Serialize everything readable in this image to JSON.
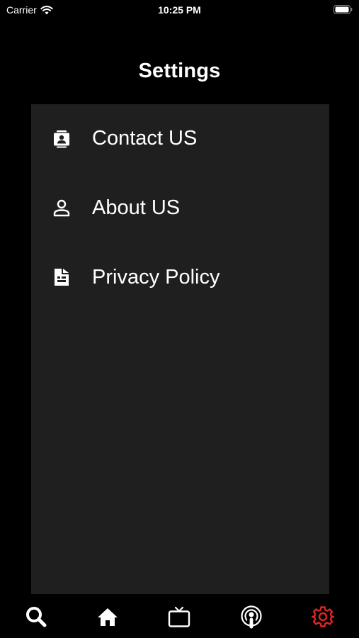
{
  "status_bar": {
    "carrier": "Carrier",
    "time": "10:25 PM"
  },
  "header": {
    "title": "Settings"
  },
  "menu": {
    "items": [
      {
        "label": "Contact US",
        "icon": "contact-card-icon"
      },
      {
        "label": "About US",
        "icon": "person-icon"
      },
      {
        "label": "Privacy Policy",
        "icon": "document-icon"
      }
    ]
  },
  "tab_bar": {
    "tabs": [
      {
        "icon": "search-icon",
        "active": false
      },
      {
        "icon": "home-icon",
        "active": false
      },
      {
        "icon": "tv-icon",
        "active": false
      },
      {
        "icon": "podcast-icon",
        "active": false
      },
      {
        "icon": "gear-icon",
        "active": true
      }
    ]
  },
  "colors": {
    "background": "#000000",
    "panel": "#1f1f1f",
    "text": "#ffffff",
    "active_tab": "#e02424"
  }
}
